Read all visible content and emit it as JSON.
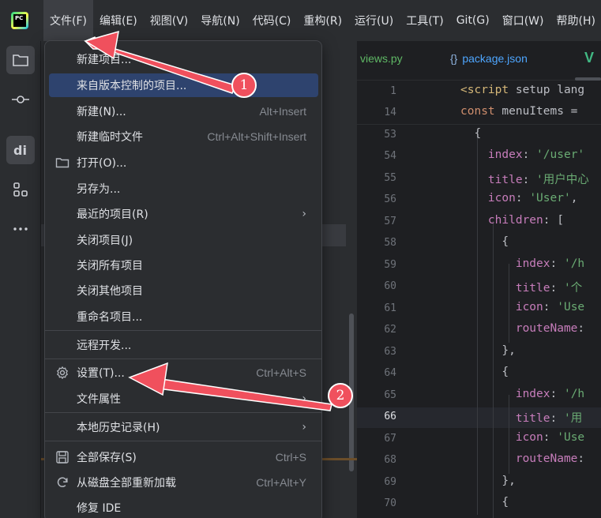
{
  "menubar": {
    "logo_text": "PC",
    "items": [
      {
        "label": "文件(F)"
      },
      {
        "label": "编辑(E)"
      },
      {
        "label": "视图(V)"
      },
      {
        "label": "导航(N)"
      },
      {
        "label": "代码(C)"
      },
      {
        "label": "重构(R)"
      },
      {
        "label": "运行(U)"
      },
      {
        "label": "工具(T)"
      },
      {
        "label": "Git(G)"
      },
      {
        "label": "窗口(W)"
      },
      {
        "label": "帮助(H)"
      }
    ]
  },
  "toolstrip": {
    "icons": [
      "folder-icon",
      "commit-icon",
      "data-icon",
      "structure-icon",
      "more-icon"
    ]
  },
  "tabs": {
    "views": "views.py",
    "package": "package.json",
    "package_icon": "{}",
    "vue": "V"
  },
  "editor": {
    "lines": [
      {
        "num": "1",
        "code": [
          [
            "tag",
            "<script"
          ],
          [
            "punc",
            " setup lang"
          ]
        ]
      },
      {
        "num": "14",
        "code": [
          [
            "kw",
            "const"
          ],
          [
            "punc",
            " menuItems ="
          ]
        ]
      },
      {
        "num": "53",
        "code": [
          [
            "punc",
            "  {"
          ]
        ]
      },
      {
        "num": "54",
        "code": [
          [
            "prop",
            "    index"
          ],
          [
            "punc",
            ": "
          ],
          [
            "str",
            "'/user'"
          ]
        ]
      },
      {
        "num": "55",
        "code": [
          [
            "prop",
            "    title"
          ],
          [
            "punc",
            ": "
          ],
          [
            "str",
            "'用户中心"
          ]
        ]
      },
      {
        "num": "56",
        "code": [
          [
            "prop",
            "    icon"
          ],
          [
            "punc",
            ": "
          ],
          [
            "str",
            "'User'"
          ],
          [
            "punc",
            ","
          ]
        ]
      },
      {
        "num": "57",
        "code": [
          [
            "prop",
            "    children"
          ],
          [
            "punc",
            ": ["
          ]
        ]
      },
      {
        "num": "58",
        "code": [
          [
            "punc",
            "      {"
          ]
        ]
      },
      {
        "num": "59",
        "code": [
          [
            "prop",
            "        index"
          ],
          [
            "punc",
            ": "
          ],
          [
            "str",
            "'/h"
          ]
        ]
      },
      {
        "num": "60",
        "code": [
          [
            "prop",
            "        title"
          ],
          [
            "punc",
            ": "
          ],
          [
            "str",
            "'个"
          ]
        ]
      },
      {
        "num": "61",
        "code": [
          [
            "prop",
            "        icon"
          ],
          [
            "punc",
            ": "
          ],
          [
            "str",
            "'Use"
          ]
        ]
      },
      {
        "num": "62",
        "code": [
          [
            "prop",
            "        routeName"
          ],
          [
            "punc",
            ":"
          ]
        ]
      },
      {
        "num": "63",
        "code": [
          [
            "punc",
            "      },"
          ]
        ]
      },
      {
        "num": "64",
        "code": [
          [
            "punc",
            "      {"
          ]
        ]
      },
      {
        "num": "65",
        "code": [
          [
            "prop",
            "        index"
          ],
          [
            "punc",
            ": "
          ],
          [
            "str",
            "'/h"
          ]
        ]
      },
      {
        "num": "66",
        "code": [
          [
            "prop",
            "        title"
          ],
          [
            "punc",
            ": "
          ],
          [
            "str",
            "'用"
          ]
        ]
      },
      {
        "num": "67",
        "code": [
          [
            "prop",
            "        icon"
          ],
          [
            "punc",
            ": "
          ],
          [
            "str",
            "'Use"
          ]
        ]
      },
      {
        "num": "68",
        "code": [
          [
            "prop",
            "        routeName"
          ],
          [
            "punc",
            ":"
          ]
        ]
      },
      {
        "num": "69",
        "code": [
          [
            "punc",
            "      },"
          ]
        ]
      },
      {
        "num": "70",
        "code": [
          [
            "punc",
            "      {"
          ]
        ]
      }
    ],
    "current_line": "66"
  },
  "file_menu": {
    "items": [
      {
        "label": "新建项目...",
        "shortcut": "",
        "submenu": false,
        "icon": ""
      },
      {
        "label": "来自版本控制的项目...",
        "shortcut": "",
        "submenu": false,
        "icon": "",
        "selected": true
      },
      {
        "label": "新建(N)...",
        "shortcut": "Alt+Insert",
        "submenu": false,
        "icon": ""
      },
      {
        "label": "新建临时文件",
        "shortcut": "Ctrl+Alt+Shift+Insert",
        "submenu": false,
        "icon": ""
      },
      {
        "label": "打开(O)...",
        "shortcut": "",
        "submenu": false,
        "icon": "folder-icon"
      },
      {
        "label": "另存为...",
        "shortcut": "",
        "submenu": false,
        "icon": ""
      },
      {
        "label": "最近的项目(R)",
        "shortcut": "",
        "submenu": true,
        "icon": ""
      },
      {
        "label": "关闭项目(J)",
        "shortcut": "",
        "submenu": false,
        "icon": ""
      },
      {
        "label": "关闭所有项目",
        "shortcut": "",
        "submenu": false,
        "icon": ""
      },
      {
        "label": "关闭其他项目",
        "shortcut": "",
        "submenu": false,
        "icon": ""
      },
      {
        "label": "重命名项目...",
        "shortcut": "",
        "submenu": false,
        "icon": "",
        "sep_after": true
      },
      {
        "label": "远程开发...",
        "shortcut": "",
        "submenu": false,
        "icon": "",
        "sep_after": true
      },
      {
        "label": "设置(T)...",
        "shortcut": "Ctrl+Alt+S",
        "submenu": false,
        "icon": "gear-icon"
      },
      {
        "label": "文件属性",
        "shortcut": "",
        "submenu": true,
        "icon": "",
        "sep_after": true
      },
      {
        "label": "本地历史记录(H)",
        "shortcut": "",
        "submenu": true,
        "icon": "",
        "sep_after": true
      },
      {
        "label": "全部保存(S)",
        "shortcut": "Ctrl+S",
        "submenu": false,
        "icon": "save-icon"
      },
      {
        "label": "从磁盘全部重新加载",
        "shortcut": "Ctrl+Alt+Y",
        "submenu": false,
        "icon": "reload-icon"
      },
      {
        "label": "修复 IDE",
        "shortcut": "",
        "submenu": false,
        "icon": ""
      }
    ],
    "submenu_arrow": "›"
  },
  "annotations": {
    "badge1": "1",
    "badge2": "2",
    "color": "#f0505d"
  }
}
